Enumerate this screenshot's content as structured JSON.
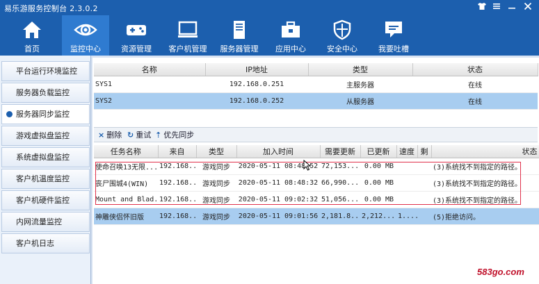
{
  "window": {
    "title": "易乐游服务控制台 2.3.0.2"
  },
  "nav": [
    {
      "label": "首页",
      "icon": "home-icon"
    },
    {
      "label": "监控中心",
      "icon": "eye-icon"
    },
    {
      "label": "资源管理",
      "icon": "gamepad-icon"
    },
    {
      "label": "客户机管理",
      "icon": "monitor-icon"
    },
    {
      "label": "服务器管理",
      "icon": "server-icon"
    },
    {
      "label": "应用中心",
      "icon": "toolbox-icon"
    },
    {
      "label": "安全中心",
      "icon": "shield-icon"
    },
    {
      "label": "我要吐槽",
      "icon": "chat-icon"
    }
  ],
  "sidebar": [
    {
      "label": "平台运行环境监控"
    },
    {
      "label": "服务器负载监控"
    },
    {
      "label": "服务器同步监控"
    },
    {
      "label": "游戏虚拟盘监控"
    },
    {
      "label": "系统虚拟盘监控"
    },
    {
      "label": "客户机温度监控"
    },
    {
      "label": "客户机硬件监控"
    },
    {
      "label": "内网流量监控"
    },
    {
      "label": "客户机日志"
    }
  ],
  "servers": {
    "columns": [
      "名称",
      "IP地址",
      "类型",
      "状态"
    ],
    "rows": [
      [
        "SYS1",
        "192.168.0.251",
        "主服务器",
        "在线"
      ],
      [
        "SYS2",
        "192.168.0.252",
        "从服务器",
        "在线"
      ]
    ]
  },
  "toolbar": {
    "delete": "删除",
    "retry": "重试",
    "priority": "优先同步"
  },
  "tasks": {
    "columns": [
      "任务名称",
      "来自",
      "类型",
      "加入时间",
      "需要更新",
      "已更新",
      "速度",
      "剩",
      "状态"
    ],
    "rows": [
      [
        "使命召唤13无限...",
        "192.168...",
        "游戏同步",
        "2020-05-11 08:48:52",
        "72,153....",
        "0.00 MB",
        "",
        "",
        "(3)系统找不到指定的路径。"
      ],
      [
        "丧尸围城4(WIN)",
        "192.168...",
        "游戏同步",
        "2020-05-11 08:48:32",
        "66,990....",
        "0.00 MB",
        "",
        "",
        "(3)系统找不到指定的路径。"
      ],
      [
        "Mount and Blad...",
        "192.168...",
        "游戏同步",
        "2020-05-11 09:02:32",
        "51,056....",
        "0.00 MB",
        "",
        "",
        "(3)系统找不到指定的路径。"
      ],
      [
        "神雕侠侣怀旧版",
        "192.168...",
        "游戏同步",
        "2020-05-11 09:01:56",
        "2,181.8...",
        "2,212....",
        "1....",
        "",
        "(5)拒绝访问。"
      ]
    ]
  },
  "watermark": "583go.com"
}
